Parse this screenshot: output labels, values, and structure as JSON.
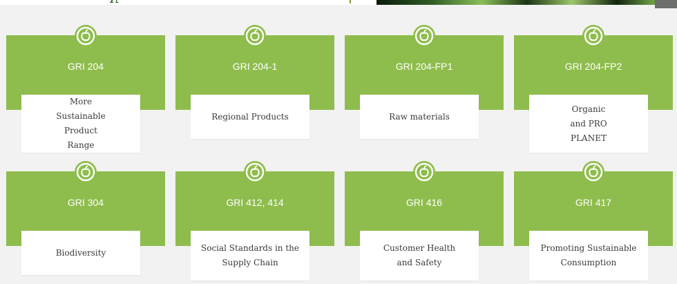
{
  "theme": {
    "card_green": "#8fbd4d",
    "label_text": "#3a3a3a"
  },
  "cards": [
    {
      "code": "GRI 204",
      "label": "More Sustainable Product Range",
      "icon": "apple-icon"
    },
    {
      "code": "GRI 204-1",
      "label": "Regional Products",
      "icon": "apple-icon"
    },
    {
      "code": "GRI 204-FP1",
      "label": "Raw materials",
      "icon": "apple-icon"
    },
    {
      "code": "GRI 204-FP2",
      "label": "Organic and PRO PLANET",
      "icon": "apple-icon"
    },
    {
      "code": "GRI 304",
      "label": "Biodiversity",
      "icon": "apple-icon"
    },
    {
      "code": "GRI 412, 414",
      "label": "Social Standards in the Supply Chain",
      "icon": "apple-icon"
    },
    {
      "code": "GRI 416",
      "label": "Customer Health and Safety",
      "icon": "apple-icon"
    },
    {
      "code": "GRI 417",
      "label": "Promoting Sustainable Consumption",
      "icon": "apple-icon"
    }
  ]
}
